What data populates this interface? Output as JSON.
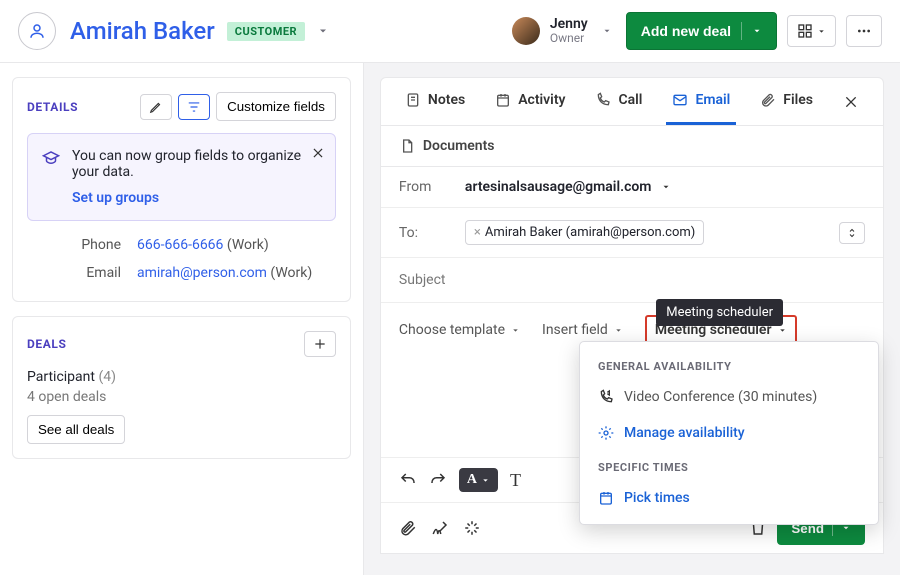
{
  "header": {
    "person_name": "Amirah Baker",
    "badge": "CUSTOMER",
    "owner_name": "Jenny",
    "owner_role": "Owner",
    "add_deal": "Add new deal"
  },
  "details": {
    "title": "DETAILS",
    "customize": "Customize fields",
    "banner_text": "You can now group fields to organize your data.",
    "banner_link": "Set up groups",
    "phone_label": "Phone",
    "phone_value": "666-666-6666",
    "phone_tag": "(Work)",
    "email_label": "Email",
    "email_value": "amirah@person.com",
    "email_tag": "(Work)"
  },
  "deals": {
    "title": "DEALS",
    "participant_label": "Participant",
    "participant_count": "(4)",
    "open": "4 open deals",
    "see_all": "See all deals"
  },
  "tabs": {
    "notes": "Notes",
    "activity": "Activity",
    "call": "Call",
    "email": "Email",
    "files": "Files",
    "documents": "Documents"
  },
  "compose": {
    "from_label": "From",
    "from_value": "artesinalsausage@gmail.com",
    "to_label": "To:",
    "to_chip": "Amirah Baker (amirah@person.com)",
    "subject_label": "Subject",
    "choose_template": "Choose template",
    "insert_field": "Insert field",
    "meeting_scheduler": "Meeting scheduler",
    "tooltip": "Meeting scheduler"
  },
  "scheduler": {
    "general_header": "GENERAL AVAILABILITY",
    "video_conf": "Video Conference (30 minutes)",
    "manage": "Manage availability",
    "specific_header": "SPECIFIC TIMES",
    "pick": "Pick times"
  },
  "send": "Send"
}
